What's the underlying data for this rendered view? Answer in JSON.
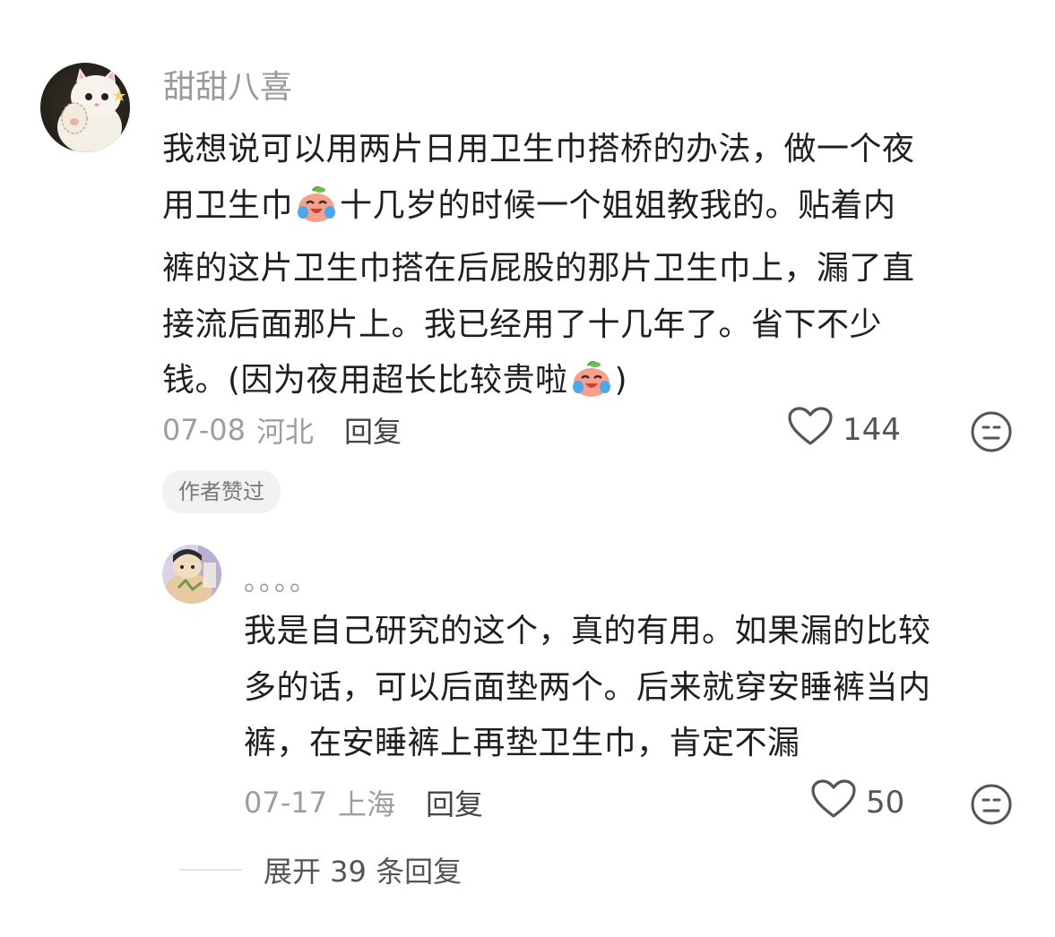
{
  "comments": [
    {
      "username": "甜甜八喜",
      "lines": [
        "我想说可以用两片日用卫生巾搭桥的办法，做一个夜",
        "用卫生巾",
        "十几岁的时候一个姐姐教我的。贴着内",
        "裤的这片卫生巾搭在后屁股的那片卫生巾上，漏了直",
        "接流后面那片上。我已经用了十几年了。省下不少",
        "钱。(因为夜用超长比较贵啦",
        ")"
      ],
      "date": "07-08",
      "location": "河北",
      "reply_label": "回复",
      "likes": "144",
      "badge": "作者赞过"
    },
    {
      "username": "。。。。",
      "lines": [
        "我是自己研究的这个，真的有用。如果漏的比较",
        "多的话，可以后面垫两个。后来就穿安睡裤当内",
        "裤，在安睡裤上再垫卫生巾，肯定不漏"
      ],
      "date": "07-17",
      "location": "上海",
      "reply_label": "回复",
      "likes": "50"
    }
  ],
  "expand_replies_label": "展开 39 条回复",
  "icons": {
    "like": "heart-outline-icon",
    "dislike": "meh-face-icon",
    "emoji": "crying-laughing-peach-emoji"
  },
  "colors": {
    "text": "#1f1f1f",
    "meta": "#9e9e9e",
    "username": "#9a9a9a",
    "badge_bg": "#f2f2f2",
    "icon": "#555555"
  }
}
